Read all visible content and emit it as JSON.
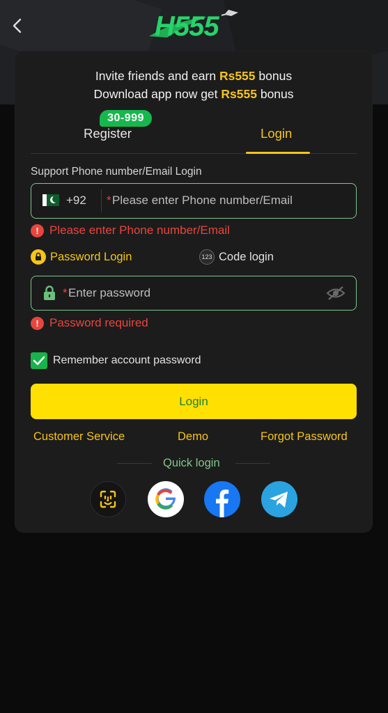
{
  "header": {
    "logo_text": "H555"
  },
  "invite": {
    "line1_prefix": "Invite friends and earn ",
    "line1_amount": "Rs555",
    "line1_suffix": " bonus",
    "line2_prefix": "Download app now get ",
    "line2_amount": "Rs555",
    "line2_suffix": " bonus"
  },
  "tabs": {
    "register": "Register",
    "register_badge": "30-999",
    "login": "Login"
  },
  "phone": {
    "label": "Support Phone number/Email Login",
    "country_code": "+92",
    "placeholder": "Please enter Phone number/Email",
    "required_mark": "*",
    "error": "Please enter Phone number/Email"
  },
  "login_modes": {
    "password": "Password Login",
    "code": "Code login",
    "code_icon_text": "123"
  },
  "password": {
    "placeholder": "Enter password",
    "required_mark": "*",
    "error": "Password required"
  },
  "remember": {
    "label": "Remember account password",
    "checked": true
  },
  "login_button": "Login",
  "links": {
    "customer_service": "Customer Service",
    "demo": "Demo",
    "forgot": "Forgot Password"
  },
  "quick_login": {
    "title": "Quick login",
    "providers": [
      "face-id",
      "google",
      "facebook",
      "telegram"
    ]
  },
  "colors": {
    "accent_yellow": "#f5c518",
    "button_yellow": "#ffe000",
    "error_red": "#e8453c",
    "field_border": "#7fc78a",
    "badge_green": "#16b84e"
  }
}
